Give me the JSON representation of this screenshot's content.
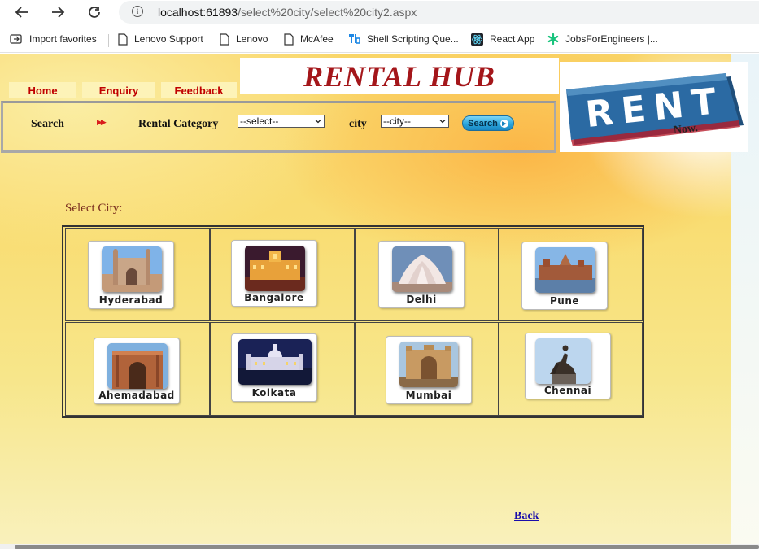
{
  "browser": {
    "url_host": "localhost:61893",
    "url_path": "/select%20city/select%20city2.aspx",
    "bookmarks": [
      "Import favorites",
      "Lenovo Support",
      "Lenovo",
      "McAfee",
      "Shell Scripting Que...",
      "React App",
      "JobsForEngineers |..."
    ]
  },
  "site": {
    "title": "RENTAL HUB",
    "menu": [
      "Home",
      "Enquiry",
      "Feedback"
    ],
    "rent_logo": {
      "word": "RENT",
      "tag": "Now."
    }
  },
  "search": {
    "label": "Search",
    "category_label": "Rental Category",
    "category_selected": "--select--",
    "city_label": "city",
    "city_selected": "--city--",
    "button_label": "Search"
  },
  "main": {
    "heading": "Select City:",
    "cities": [
      "Hyderabad",
      "Bangalore",
      "Delhi",
      "Pune",
      "Ahemadabad",
      "Kolkata",
      "Mumbai",
      "Chennai"
    ],
    "back_label": "Back"
  },
  "colors": {
    "menu_text": "#c00000",
    "title": "#a4161a",
    "heading": "#7b2f1f",
    "link": "#1a0dab"
  }
}
